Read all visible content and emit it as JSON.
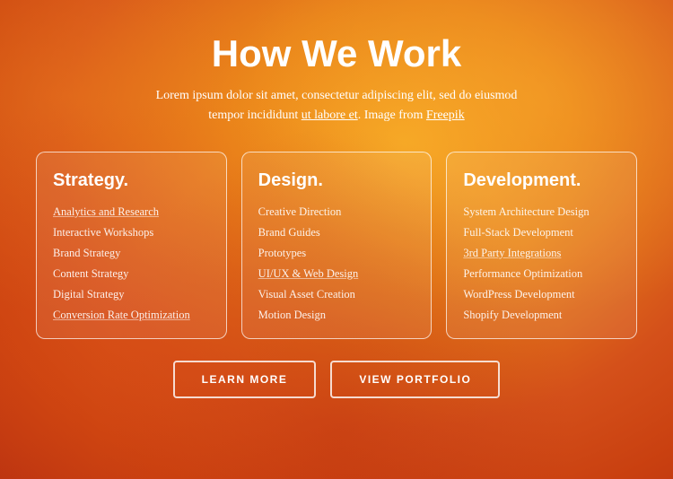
{
  "header": {
    "title": "How We Work",
    "subtitle_1": "Lorem ipsum dolor sit amet, consectetur adipiscing elit, sed do eiusmod",
    "subtitle_2": "tempor incididunt ut labore et. Image from Freepik",
    "subtitle_link1": "labore et",
    "subtitle_link2": "Freepik"
  },
  "cards": [
    {
      "id": "strategy",
      "title": "Strategy.",
      "items": [
        {
          "text": "Analytics and Research",
          "link": true
        },
        {
          "text": "Interactive Workshops",
          "link": false
        },
        {
          "text": "Brand Strategy",
          "link": false
        },
        {
          "text": "Content Strategy",
          "link": false
        },
        {
          "text": "Digital Strategy",
          "link": false
        },
        {
          "text": "Conversion Rate Optimization",
          "link": true
        }
      ]
    },
    {
      "id": "design",
      "title": "Design.",
      "items": [
        {
          "text": "Creative Direction",
          "link": false
        },
        {
          "text": "Brand Guides",
          "link": false
        },
        {
          "text": "Prototypes",
          "link": false
        },
        {
          "text": "UI/UX & Web Design",
          "link": true
        },
        {
          "text": "Visual Asset Creation",
          "link": false
        },
        {
          "text": "Motion Design",
          "link": false
        }
      ]
    },
    {
      "id": "development",
      "title": "Development.",
      "items": [
        {
          "text": "System Architecture Design",
          "link": false
        },
        {
          "text": "Full-Stack Development",
          "link": false
        },
        {
          "text": "3rd Party Integrations",
          "link": true
        },
        {
          "text": "Performance Optimization",
          "link": false
        },
        {
          "text": "WordPress Development",
          "link": false
        },
        {
          "text": "Shopify Development",
          "link": false
        }
      ]
    }
  ],
  "buttons": [
    {
      "id": "learn-more",
      "label": "LEARN MORE"
    },
    {
      "id": "view-portfolio",
      "label": "VIEW PORTFOLIO"
    }
  ]
}
